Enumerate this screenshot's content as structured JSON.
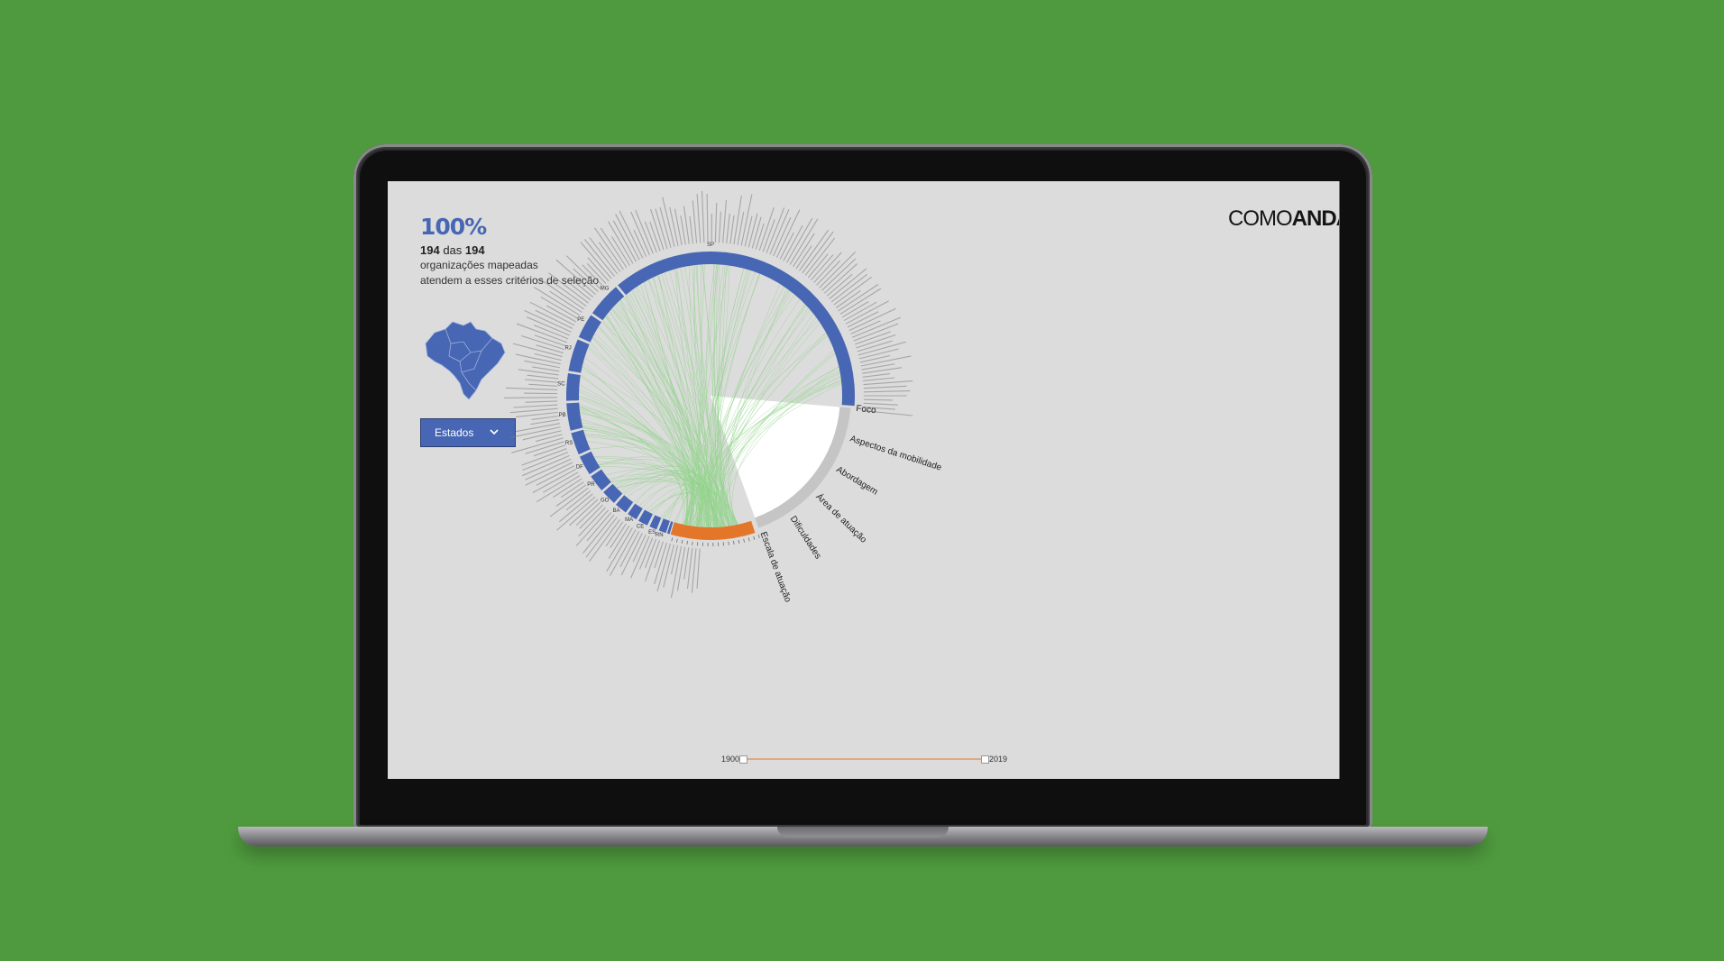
{
  "header": {
    "percent": "100%",
    "count_a": "194",
    "count_sep": " das ",
    "count_b": "194",
    "line2": "organizações mapeadas",
    "line3": "atendem a esses critérios de seleção"
  },
  "filter": {
    "label": "Estados"
  },
  "brand": {
    "part1": "COMO",
    "part2": "ANDA"
  },
  "chart_data": {
    "type": "chord",
    "state_labels": [
      "SP",
      "MG",
      "PE",
      "RJ",
      "SC",
      "PB",
      "RS",
      "DF",
      "PR",
      "GO",
      "BA",
      "MA",
      "CE",
      "ES",
      "RN"
    ],
    "categories": [
      "Foco",
      "Aspectos da mobilidade",
      "Abordagem",
      "Área de atuação",
      "Dificuldades",
      "Escala de atuação"
    ],
    "organizations_total": 194,
    "organizations_selected": 194
  },
  "timeline": {
    "start": "1900",
    "end": "2019"
  },
  "colors": {
    "states": "#4766b3",
    "links": "#93d38c",
    "highlight": "#e4762a",
    "categories": "#c5c5c5"
  }
}
